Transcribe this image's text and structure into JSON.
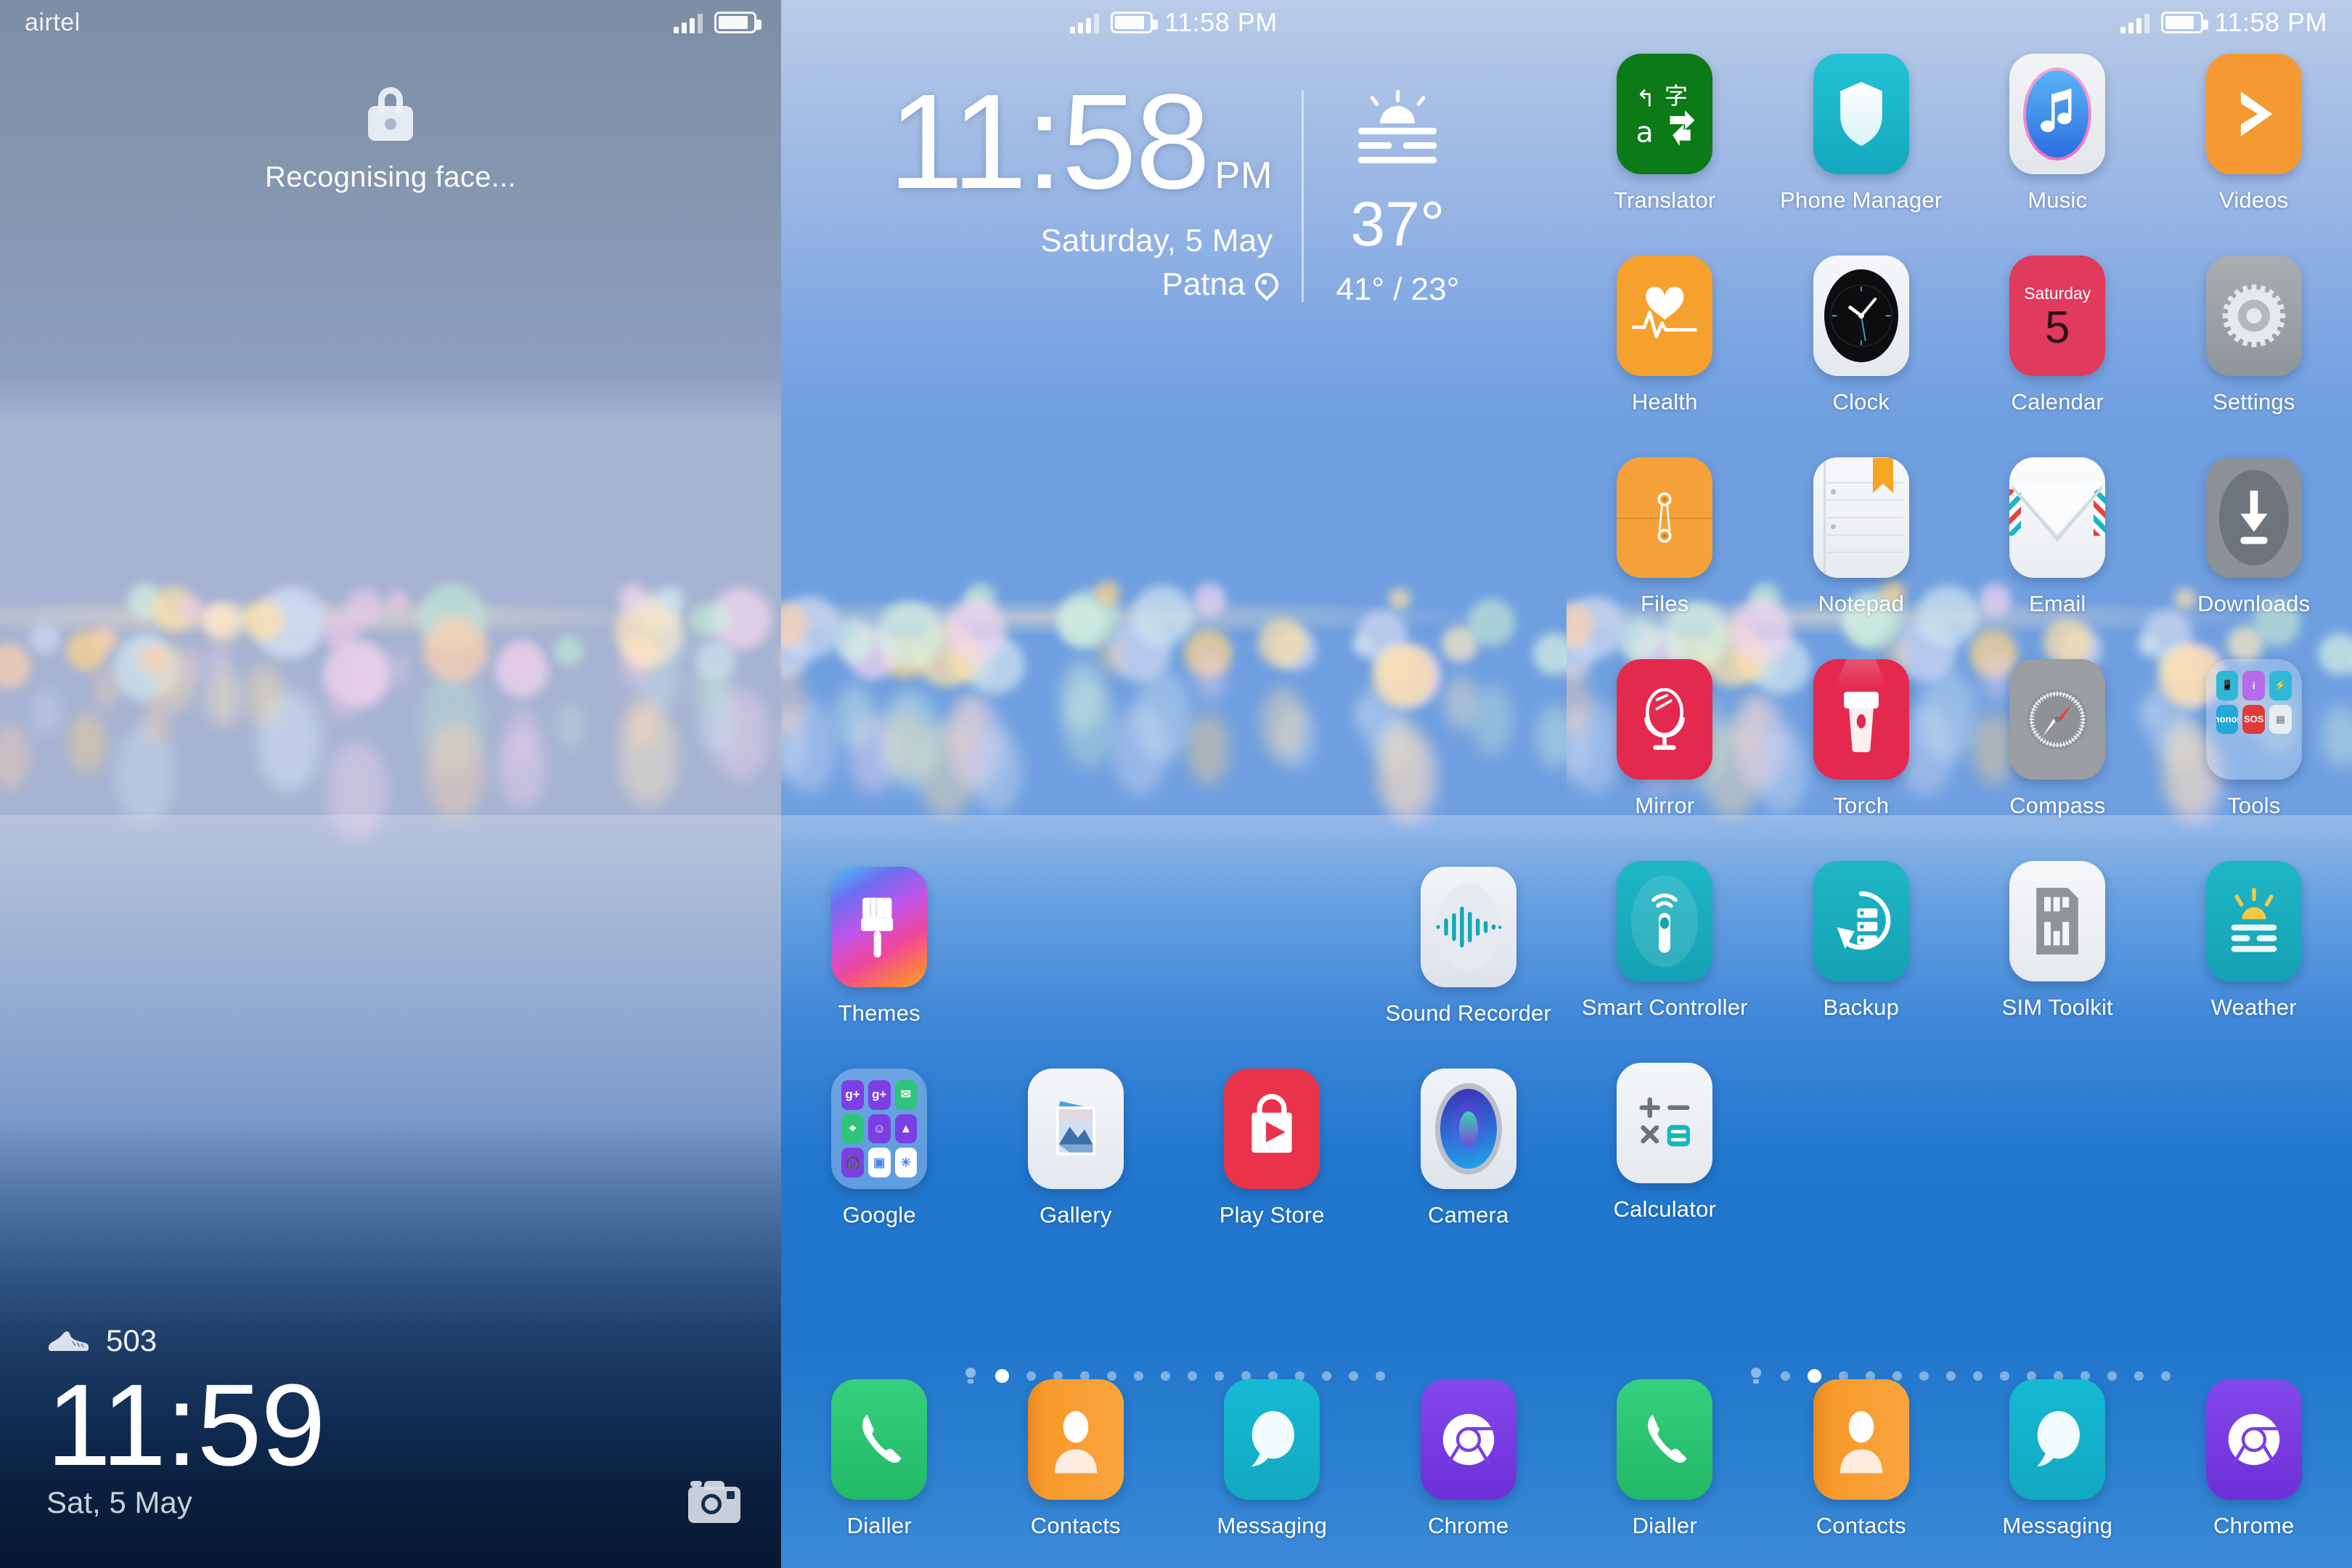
{
  "panels": {
    "lock": {
      "status": {
        "carrier": "airtel",
        "signal_icon": "signal-bars-icon",
        "battery_icon": "battery-icon"
      },
      "lock_icon": "lock-icon",
      "message": "Recognising face...",
      "steps_icon": "shoe-icon",
      "steps": "503",
      "time": "11:59",
      "date": "Sat, 5 May",
      "camera_icon": "camera-icon"
    },
    "home": {
      "status": {
        "signal_icon": "signal-bars-icon",
        "battery_icon": "battery-icon",
        "clock": "11:58 PM"
      },
      "widget": {
        "time": "11:58",
        "meridiem": "PM",
        "date": "Saturday, 5 May",
        "location": "Patna",
        "location_icon": "location-pin-icon",
        "weather_icon": "haze-sun-icon",
        "temp": "37°",
        "range": "41° / 23°"
      },
      "apps": [
        {
          "label": "Themes",
          "icon": "themes-icon"
        },
        {
          "label": "",
          "icon": ""
        },
        {
          "label": "",
          "icon": ""
        },
        {
          "label": "Sound Recorder",
          "icon": "sound-recorder-icon"
        },
        {
          "label": "Google",
          "icon": "google-folder-icon"
        },
        {
          "label": "Gallery",
          "icon": "gallery-icon"
        },
        {
          "label": "Play Store",
          "icon": "play-store-icon"
        },
        {
          "label": "Camera",
          "icon": "camera-app-icon"
        }
      ],
      "page_indicator": {
        "home_icon": "home-icon",
        "total": 15,
        "active": 1
      },
      "dock": [
        {
          "label": "Dialler",
          "icon": "phone-icon"
        },
        {
          "label": "Contacts",
          "icon": "contacts-icon"
        },
        {
          "label": "Messaging",
          "icon": "message-bubble-icon"
        },
        {
          "label": "Chrome",
          "icon": "chrome-icon"
        }
      ]
    },
    "apps": {
      "status": {
        "signal_icon": "signal-bars-icon",
        "battery_icon": "battery-icon",
        "clock": "11:58 PM"
      },
      "apps": [
        {
          "label": "Translator",
          "icon": "translator-icon"
        },
        {
          "label": "Phone Manager",
          "icon": "shield-icon"
        },
        {
          "label": "Music",
          "icon": "music-note-icon"
        },
        {
          "label": "Videos",
          "icon": "videos-play-icon"
        },
        {
          "label": "Health",
          "icon": "health-heart-icon"
        },
        {
          "label": "Clock",
          "icon": "analog-clock-icon"
        },
        {
          "label": "Calendar",
          "icon": "calendar-icon"
        },
        {
          "label": "Settings",
          "icon": "gear-icon"
        },
        {
          "label": "Files",
          "icon": "files-folder-icon"
        },
        {
          "label": "Notepad",
          "icon": "notepad-icon"
        },
        {
          "label": "Email",
          "icon": "envelope-icon"
        },
        {
          "label": "Downloads",
          "icon": "download-arrow-icon"
        },
        {
          "label": "Mirror",
          "icon": "mirror-icon"
        },
        {
          "label": "Torch",
          "icon": "flashlight-icon"
        },
        {
          "label": "Compass",
          "icon": "compass-icon"
        },
        {
          "label": "Tools",
          "icon": "tools-folder-icon"
        },
        {
          "label": "Smart Controller",
          "icon": "remote-control-icon"
        },
        {
          "label": "Backup",
          "icon": "backup-icon"
        },
        {
          "label": "SIM Toolkit",
          "icon": "sim-card-icon"
        },
        {
          "label": "Weather",
          "icon": "haze-sun-icon"
        },
        {
          "label": "Calculator",
          "icon": "calculator-icon"
        },
        {
          "label": "",
          "icon": ""
        },
        {
          "label": "",
          "icon": ""
        },
        {
          "label": "",
          "icon": ""
        }
      ],
      "calendar_icon_text": {
        "weekday": "Saturday",
        "day": "5"
      },
      "page_indicator": {
        "home_icon": "home-icon",
        "total": 15,
        "active": 2
      },
      "dock": [
        {
          "label": "Dialler",
          "icon": "phone-icon"
        },
        {
          "label": "Contacts",
          "icon": "contacts-icon"
        },
        {
          "label": "Messaging",
          "icon": "message-bubble-icon"
        },
        {
          "label": "Chrome",
          "icon": "chrome-icon"
        }
      ]
    }
  },
  "colors": {
    "translator_green": "#0b7a17",
    "phone_manager_teal": "#1db9cf",
    "videos_orange": "#f59a33",
    "health_orange": "#f6a02e",
    "calendar_red": "#e03a5c",
    "settings_gray": "#9aa0a6",
    "files_orange": "#f5a13a",
    "downloads_gray": "#8c9097",
    "mirror_red": "#e4294f",
    "torch_red": "#e4294f",
    "compass_gray": "#9a9da2",
    "teal": "#16b4c4",
    "dialler_green": "#2fc46e",
    "contacts_orange": "#f89a2b",
    "messaging_teal": "#14b6c8",
    "chrome_purple": "#7b3fe4",
    "play_store_red": "#e8334a"
  }
}
